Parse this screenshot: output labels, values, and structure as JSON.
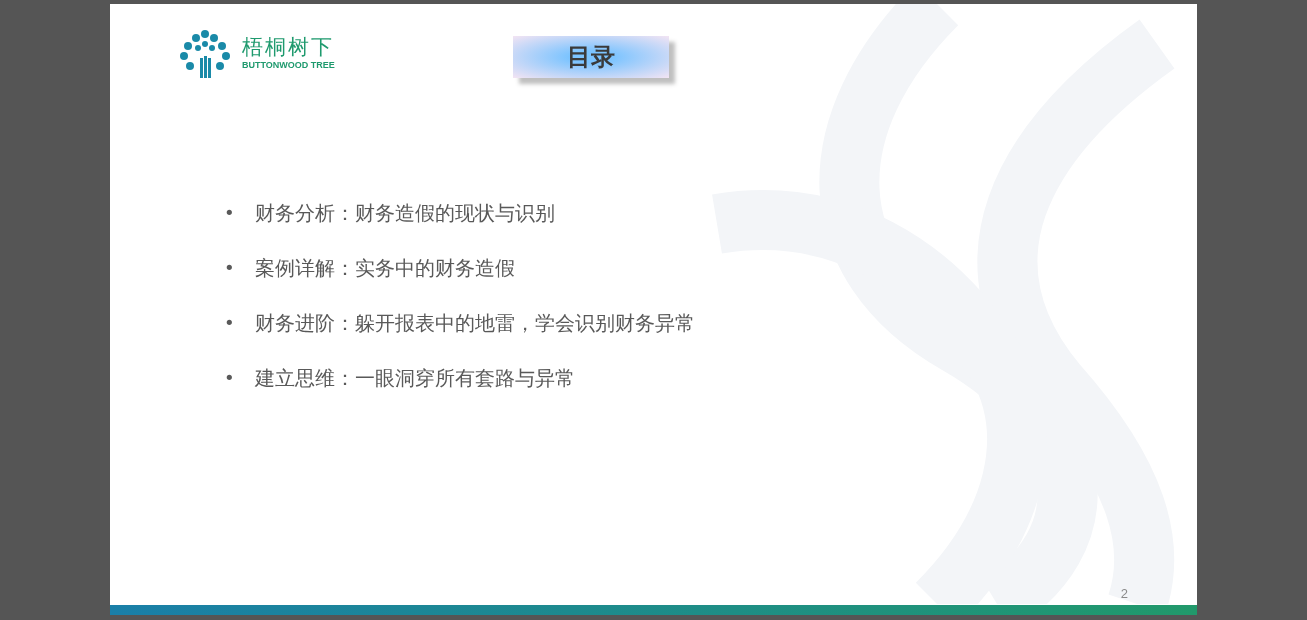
{
  "slide": {
    "logo": {
      "name": "梧桐树下",
      "subtitle": "BUTTONWOOD TREE"
    },
    "title": "目录",
    "bullets": [
      {
        "marker": "•",
        "text": "财务分析：财务造假的现状与识别"
      },
      {
        "marker": "•",
        "text": "案例详解：实务中的财务造假"
      },
      {
        "marker": "•",
        "text": "财务进阶：躲开报表中的地雷，学会识别财务异常"
      },
      {
        "marker": "•",
        "text": "建立思维：一眼洞穿所有套路与异常"
      }
    ],
    "page_number": "2"
  }
}
